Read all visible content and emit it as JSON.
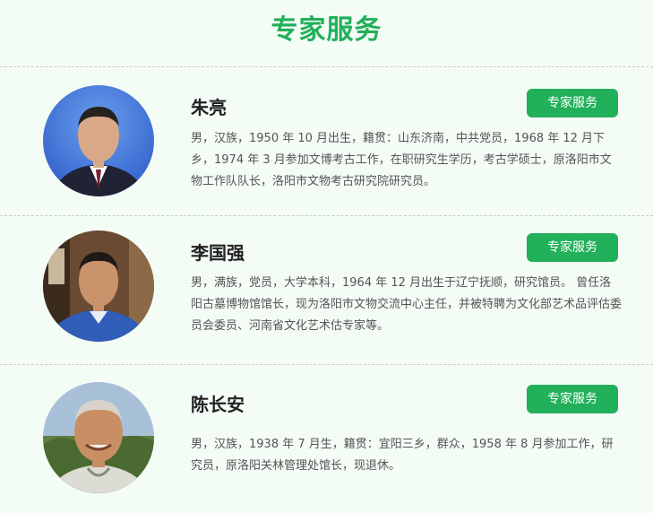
{
  "page": {
    "title": "专家服务"
  },
  "experts": [
    {
      "name": "朱亮",
      "button_label": "专家服务",
      "bio": "男，汉族，1950 年 10 月出生，籍贯：山东济南，中共党员，1968 年 12 月下乡，1974 年 3 月参加文博考古工作，在职研究生学历，考古学硕士，原洛阳市文物工作队队长，洛阳市文物考古研究院研究员。"
    },
    {
      "name": "李国强",
      "button_label": "专家服务",
      "bio": "男，满族，党员，大学本科，1964 年 12 月出生于辽宁抚顺，研究馆员。 曾任洛阳古墓博物馆馆长，现为洛阳市文物交流中心主任，并被特聘为文化部艺术品评估委员会委员、河南省文化艺术估专家等。"
    },
    {
      "name": "陈长安",
      "button_label": "专家服务",
      "bio": "男，汉族，1938 年 7 月生，籍贯：宜阳三乡，群众，1958 年 8 月参加工作，研究员，原洛阳关林管理处馆长，现退休。"
    }
  ],
  "colors": {
    "accent": "#22b05a",
    "background": "#f4fcf6"
  }
}
